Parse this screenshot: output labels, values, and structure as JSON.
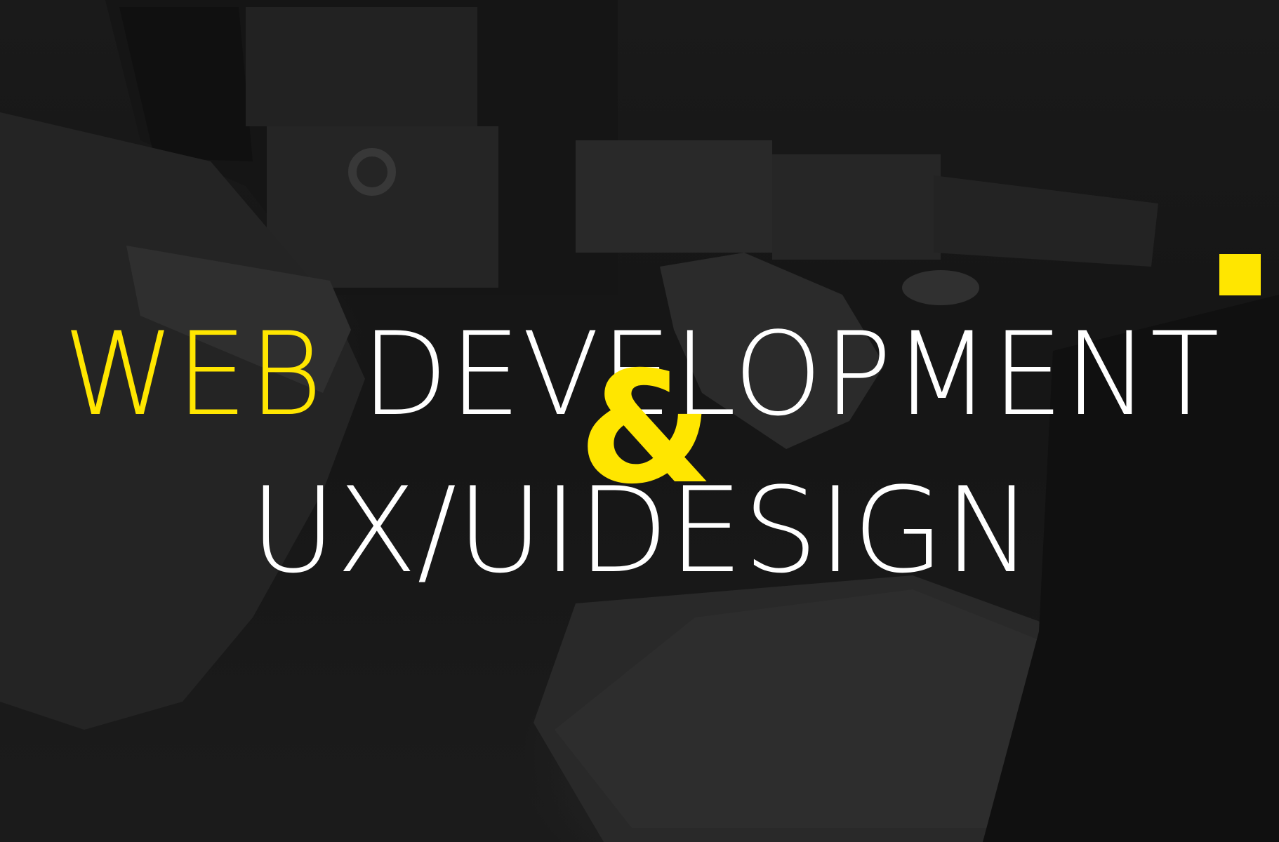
{
  "theme": {
    "accent_color": "#ffe600",
    "text_color": "#ffffff",
    "background_tone": "#1c1c1c"
  },
  "headline": {
    "highlight_word": "WEB",
    "line1_rest": "DEVELOPMENT",
    "ampersand": "&",
    "line2": "UX/UIDESIGN"
  }
}
